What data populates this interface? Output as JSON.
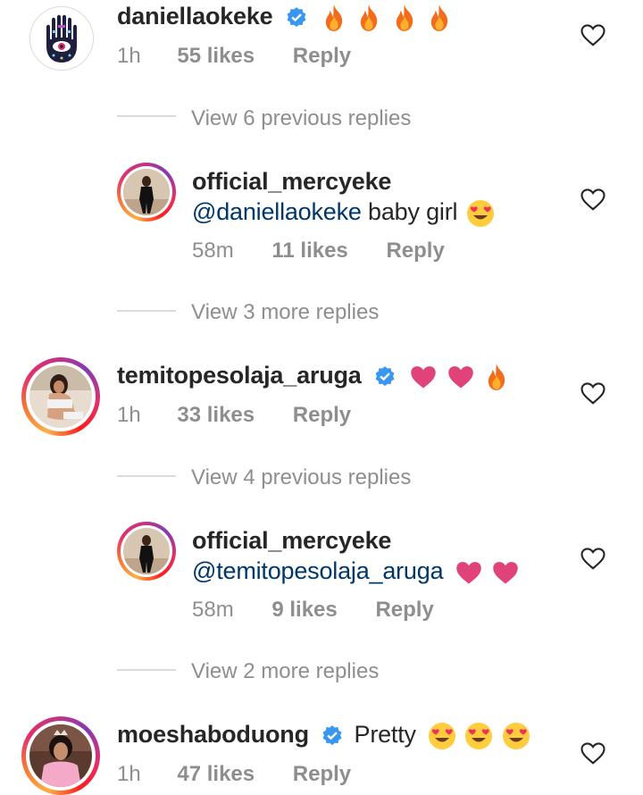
{
  "comments": [
    {
      "username": "daniellaokeke",
      "verified": true,
      "text": "",
      "emojis": [
        "fire",
        "fire",
        "fire",
        "fire"
      ],
      "time": "1h",
      "likes": "55 likes",
      "reply": "Reply",
      "view_replies": "View 6 previous replies"
    },
    {
      "username": "official_mercyeke",
      "mention": "@daniellaokeke",
      "text": " baby girl",
      "emojis": [
        "heart-eyes"
      ],
      "time": "58m",
      "likes": "11 likes",
      "reply": "Reply",
      "view_replies": "View 3 more replies"
    },
    {
      "username": "temitopesolaja_aruga",
      "verified": true,
      "emojis": [
        "pink-heart",
        "pink-heart",
        "fire"
      ],
      "time": "1h",
      "likes": "33 likes",
      "reply": "Reply",
      "view_replies": "View 4 previous replies"
    },
    {
      "username": "official_mercyeke",
      "mention": "@temitopesolaja_aruga",
      "emojis": [
        "pink-heart",
        "pink-heart"
      ],
      "time": "58m",
      "likes": "9 likes",
      "reply": "Reply",
      "view_replies": "View 2 more replies"
    },
    {
      "username": "moeshaboduong",
      "verified": true,
      "text": "Pretty",
      "emojis": [
        "heart-eyes",
        "heart-eyes",
        "heart-eyes"
      ],
      "time": "1h",
      "likes": "47 likes",
      "reply": "Reply"
    }
  ],
  "colors": {
    "text": "#262626",
    "secondary": "#8e8e8e",
    "mention": "#00376b",
    "verified": "#3897f0",
    "divider": "#dbdbdb"
  }
}
